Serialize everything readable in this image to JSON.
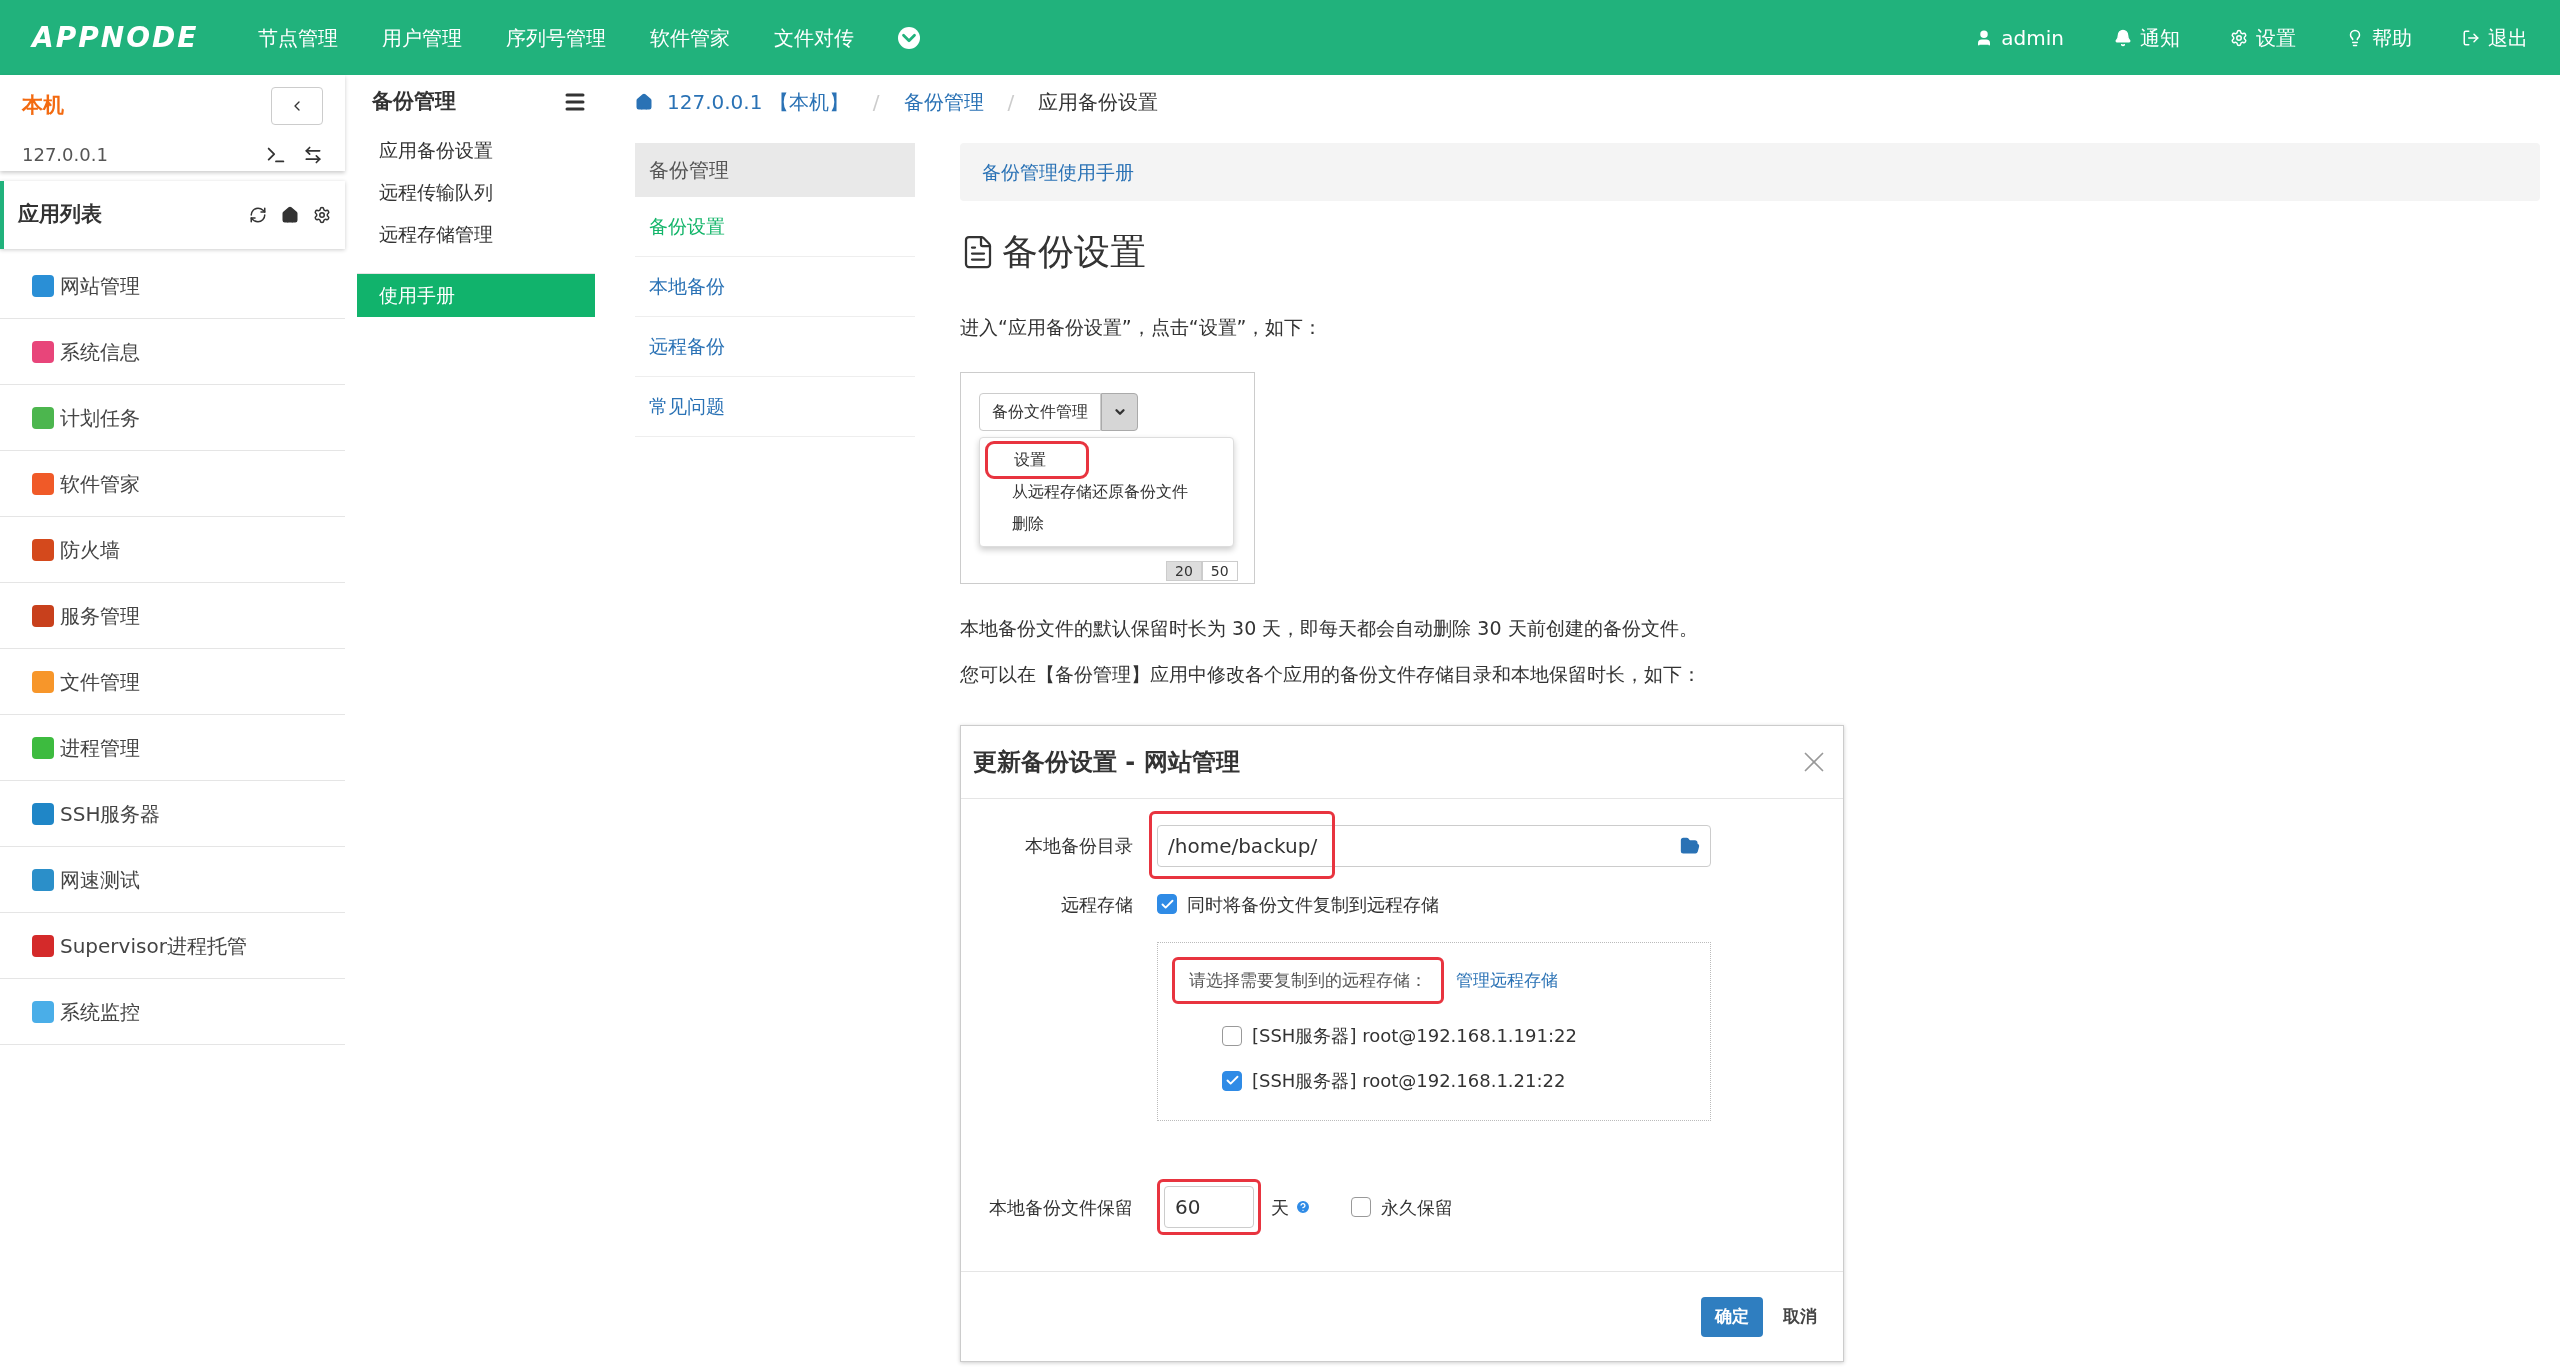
{
  "topbar": {
    "logo": "APPNODE",
    "nav": [
      "节点管理",
      "用户管理",
      "序列号管理",
      "软件管家",
      "文件对传"
    ],
    "user_menu": [
      {
        "kind": "user",
        "label": "admin"
      },
      {
        "kind": "notify",
        "label": "通知"
      },
      {
        "kind": "settings",
        "label": "设置"
      },
      {
        "kind": "help",
        "label": "帮助"
      },
      {
        "kind": "logout",
        "label": "退出"
      }
    ]
  },
  "host": {
    "name": "本机",
    "ip": "127.0.0.1"
  },
  "app_list": {
    "title": "应用列表",
    "items": [
      {
        "label": "网站管理",
        "color": "#2a8fd6"
      },
      {
        "label": "系统信息",
        "color": "#e8457a"
      },
      {
        "label": "计划任务",
        "color": "#4cb64e"
      },
      {
        "label": "软件管家",
        "color": "#f05a28"
      },
      {
        "label": "防火墙",
        "color": "#d4491c"
      },
      {
        "label": "服务管理",
        "color": "#c8401c"
      },
      {
        "label": "文件管理",
        "color": "#f7962a"
      },
      {
        "label": "进程管理",
        "color": "#3dbb3f"
      },
      {
        "label": "SSH服务器",
        "color": "#1f86c7"
      },
      {
        "label": "网速测试",
        "color": "#2b8fc9"
      },
      {
        "label": "Supervisor进程托管",
        "color": "#d42a2a"
      },
      {
        "label": "系统监控",
        "color": "#4aaee8"
      }
    ]
  },
  "module": {
    "title": "备份管理",
    "items": [
      {
        "label": "应用备份设置",
        "selected": false
      },
      {
        "label": "远程传输队列",
        "selected": false
      },
      {
        "label": "远程存储管理",
        "selected": false
      },
      {
        "label": "使用手册",
        "selected": true
      }
    ]
  },
  "breadcrumb": {
    "separator": "/",
    "items": [
      "127.0.0.1 【本机】",
      "备份管理",
      "应用备份设置"
    ]
  },
  "doc_nav": {
    "title": "备份管理",
    "items": [
      {
        "label": "备份设置",
        "selected": true
      },
      {
        "label": "本地备份",
        "selected": false
      },
      {
        "label": "远程备份",
        "selected": false
      },
      {
        "label": "常见问题",
        "selected": false
      }
    ]
  },
  "doc": {
    "banner": "备份管理使用手册",
    "heading": "备份设置",
    "para1": "进入“应用备份设置”，点击“设置”，如下：",
    "menu_shot": {
      "button": "备份文件管理",
      "items": [
        {
          "label": "设置",
          "highlighted": true
        },
        {
          "label": "从远程存储还原备份文件",
          "highlighted": false
        },
        {
          "label": "删除",
          "highlighted": false
        }
      ],
      "pager": [
        "20",
        "50"
      ]
    },
    "para2": "本地备份文件的默认保留时长为 30 天，即每天都会自动删除 30 天前创建的备份文件。",
    "para3": "您可以在【备份管理】应用中修改各个应用的备份文件存储目录和本地保留时长，如下：",
    "dialog": {
      "title": "更新备份设置 - 网站管理",
      "dir_label": "本地备份目录",
      "dir_value": "/home/backup/",
      "remote_label": "远程存储",
      "remote_checkbox": {
        "label": "同时将备份文件复制到远程存储",
        "checked": true
      },
      "remote_prompt": "请选择需要复制到的远程存储：",
      "remote_link": "管理远程存储",
      "remotes": [
        {
          "label": "[SSH服务器] root@192.168.1.191:22",
          "checked": false
        },
        {
          "label": "[SSH服务器] root@192.168.1.21:22",
          "checked": true
        }
      ],
      "keep_label": "本地备份文件保留",
      "keep_value": "60",
      "keep_unit": "天",
      "forever": {
        "label": "永久保留",
        "checked": false
      },
      "ok": "确定",
      "cancel": "取消"
    }
  }
}
